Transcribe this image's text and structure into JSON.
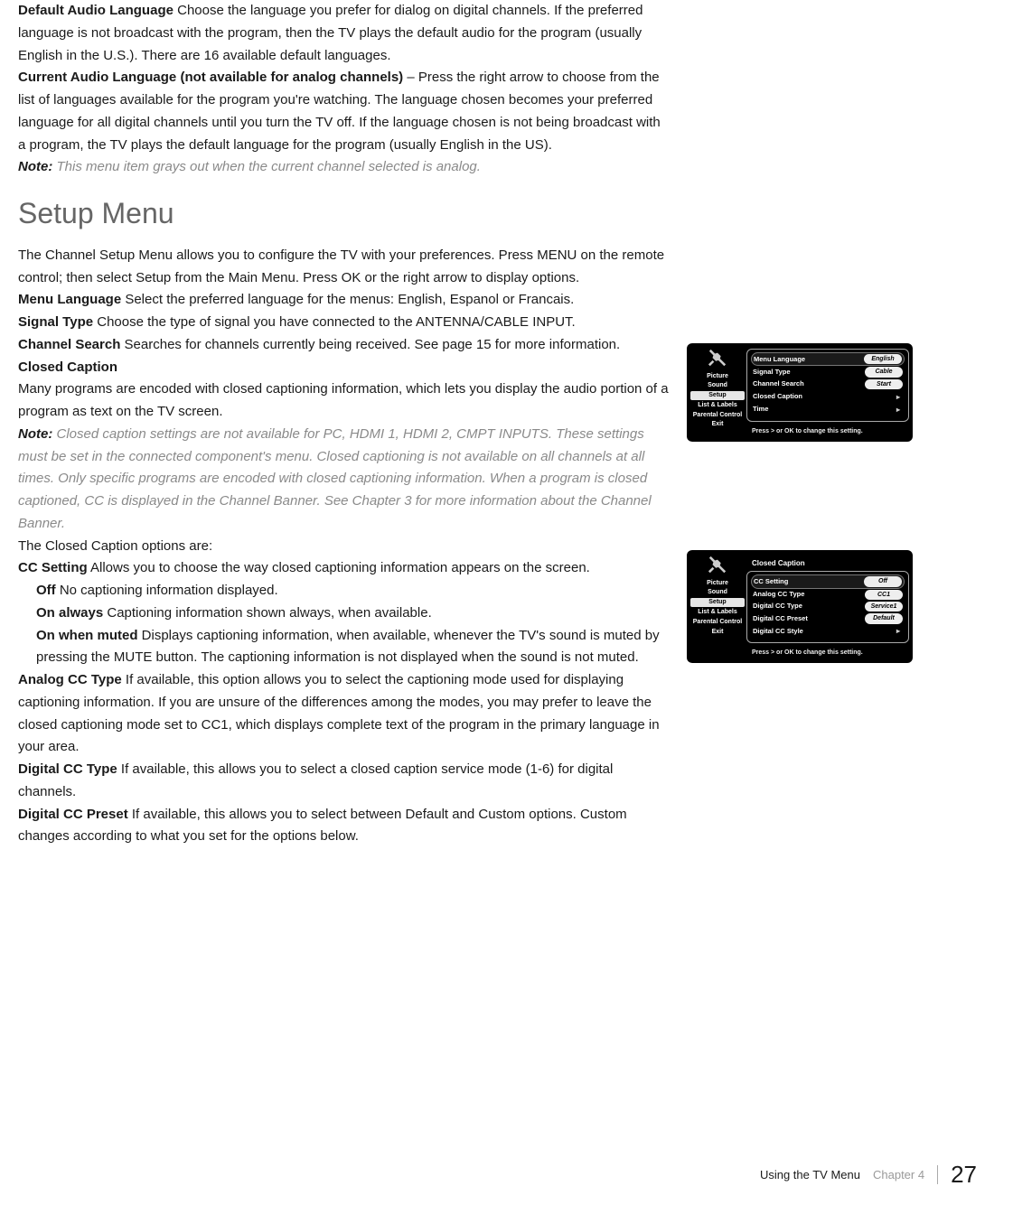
{
  "para1": {
    "bold": "Default Audio Language",
    "text": " Choose the language you prefer for dialog on digital channels. If the preferred language is not broadcast with the program, then the TV plays the default audio for the program (usually English in the U.S.). There are 16 available default languages."
  },
  "para2": {
    "bold": "Current Audio Language (not available for analog channels)",
    "text": " – Press the right arrow to choose from the list of languages available for the program you're watching. The language chosen becomes your preferred language for all digital channels until you turn the TV off. If the language chosen is not being broadcast with a program, the TV plays the default language for the program (usually English in the US)."
  },
  "note1": {
    "label": "Note:",
    "text": " This menu item grays out when the current channel selected is analog."
  },
  "setup_title": "Setup Menu",
  "setup_intro": "The Channel Setup Menu allows you to configure the TV with your preferences. Press MENU on the remote control; then select Setup from the Main Menu. Press OK or the right arrow to display options.",
  "menu_lang": {
    "bold": "Menu Language",
    "text": " Select the preferred language for the menus: English, Espanol or Francais."
  },
  "signal_type": {
    "bold": "Signal Type",
    "text": "  Choose the type of signal you have connected to the ANTENNA/CABLE INPUT."
  },
  "channel_search": {
    "bold": "Channel Search",
    "text": "  Searches for channels currently being received. See page 15 for more information."
  },
  "closed_caption_hdr": "Closed Caption",
  "closed_caption_body": "Many programs are encoded with closed captioning information, which lets you display the audio portion of a program as text on the TV screen.",
  "note2": {
    "label": "Note:",
    "text": " Closed caption settings are not available for PC, HDMI 1, HDMI 2, CMPT INPUTS. These settings must be set in the connected component's menu. Closed captioning is not available on all channels at all times. Only specific programs are encoded with closed captioning information. When a program is closed captioned, CC is displayed in the Channel Banner. See Chapter 3 for more information about the Channel Banner."
  },
  "cc_options_intro": "The Closed Caption options are:",
  "cc_setting": {
    "bold": "CC Setting",
    "text": " Allows you to choose the way closed captioning information appears on the screen."
  },
  "cc_off": {
    "bold": "Off",
    "text": "  No captioning information displayed."
  },
  "cc_on_always": {
    "bold": "On always",
    "text": "  Captioning information shown always, when available."
  },
  "cc_on_muted": {
    "bold": "On when muted",
    "text": "  Displays captioning information, when available, whenever the TV's sound is muted by pressing the MUTE button. The captioning information is not displayed when the sound is not muted."
  },
  "analog_cc": {
    "bold": "Analog CC Type",
    "text": "  If available, this option allows you to select the captioning mode used for displaying captioning information.  If you are unsure of the differences among the modes, you may prefer to leave the closed captioning mode set to CC1, which displays complete text of the program in the primary language in your area."
  },
  "digital_cc_type": {
    "bold": "Digital CC Type",
    "text": "  If available, this allows you to select a closed caption service mode (1-6) for digital channels."
  },
  "digital_cc_preset": {
    "bold": "Digital CC Preset",
    "text": "  If available, this allows you to select between Default and Custom options. Custom changes according to what you set for the options below."
  },
  "menu_sidebar": {
    "items": [
      "Picture",
      "Sound",
      "Setup",
      "List & Labels",
      "Parental Control",
      "Exit"
    ]
  },
  "menu1": {
    "rows": [
      {
        "label": "Menu Language",
        "value": "English"
      },
      {
        "label": "Signal Type",
        "value": "Cable"
      },
      {
        "label": "Channel Search",
        "value": "Start"
      },
      {
        "label": "Closed Caption",
        "arrow": true
      },
      {
        "label": "Time",
        "arrow": true
      }
    ],
    "hint": "Press > or OK to change this setting."
  },
  "menu2": {
    "title": "Closed Caption",
    "rows": [
      {
        "label": "CC Setting",
        "value": "Off"
      },
      {
        "label": "Analog CC Type",
        "value": "CC1"
      },
      {
        "label": "Digital CC Type",
        "value": "Service1"
      },
      {
        "label": "Digital CC Preset",
        "value": "Default"
      },
      {
        "label": "Digital CC Style",
        "arrow": true
      }
    ],
    "hint": "Press > or OK to change this setting."
  },
  "footer": {
    "section": "Using the TV Menu",
    "chapter": "Chapter 4",
    "page": "27"
  }
}
